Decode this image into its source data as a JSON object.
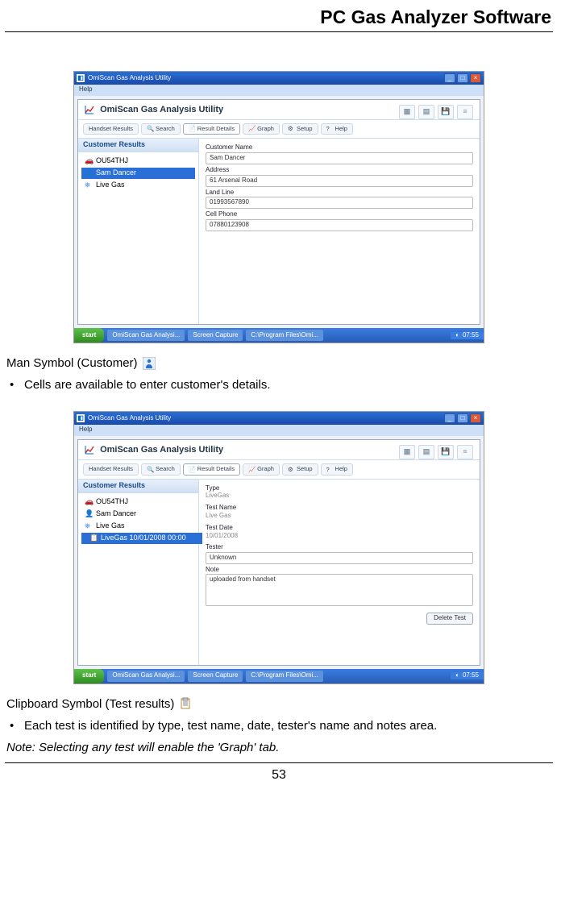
{
  "page": {
    "header": "PC Gas Analyzer Software",
    "number": "53"
  },
  "section1": {
    "caption": "Man Symbol (Customer)",
    "bullet1": "Cells are available to enter customer's details."
  },
  "section2": {
    "caption": "Clipboard Symbol (Test results)",
    "bullet1": "Each test is identified by type, test name, date, tester's name and notes area.",
    "note": "Note: Selecting any test will enable the 'Graph' tab."
  },
  "app": {
    "window_title": "OmiScan Gas Analysis Utility",
    "menu_help": "Help",
    "utility_title": "OmiScan Gas Analysis Utility",
    "tabs": {
      "handset": "Handset Results",
      "search": "Search",
      "result_details": "Result Details",
      "graph": "Graph",
      "setup": "Setup",
      "help": "Help"
    },
    "left_header": "Customer Results",
    "taskbar": {
      "start": "start",
      "item1": "OmiScan Gas Analysi...",
      "item2": "Screen Capture",
      "item3": "C:\\Program Files\\Omi...",
      "time": "07:55"
    }
  },
  "shot1": {
    "tree": {
      "vehicle": "OU54THJ",
      "customer": "Sam Dancer",
      "livegas": "Live Gas"
    },
    "fields": {
      "customer_name_label": "Customer Name",
      "customer_name": "Sam Dancer",
      "address_label": "Address",
      "address": "61 Arsenal Road",
      "landline_label": "Land Line",
      "landline": "01993567890",
      "cellphone_label": "Cell Phone",
      "cellphone": "07880123908"
    }
  },
  "shot2": {
    "tree": {
      "vehicle": "OU54THJ",
      "customer": "Sam Dancer",
      "livegas": "Live Gas",
      "test": "LiveGas 10/01/2008 00:00"
    },
    "fields": {
      "type_label": "Type",
      "type": "LiveGas",
      "testname_label": "Test Name",
      "testname": "Live Gas",
      "testdate_label": "Test Date",
      "testdate": "10/01/2008",
      "tester_label": "Tester",
      "tester": "Unknown",
      "note_label": "Note",
      "note": "uploaded from handset",
      "delete": "Delete Test"
    }
  }
}
